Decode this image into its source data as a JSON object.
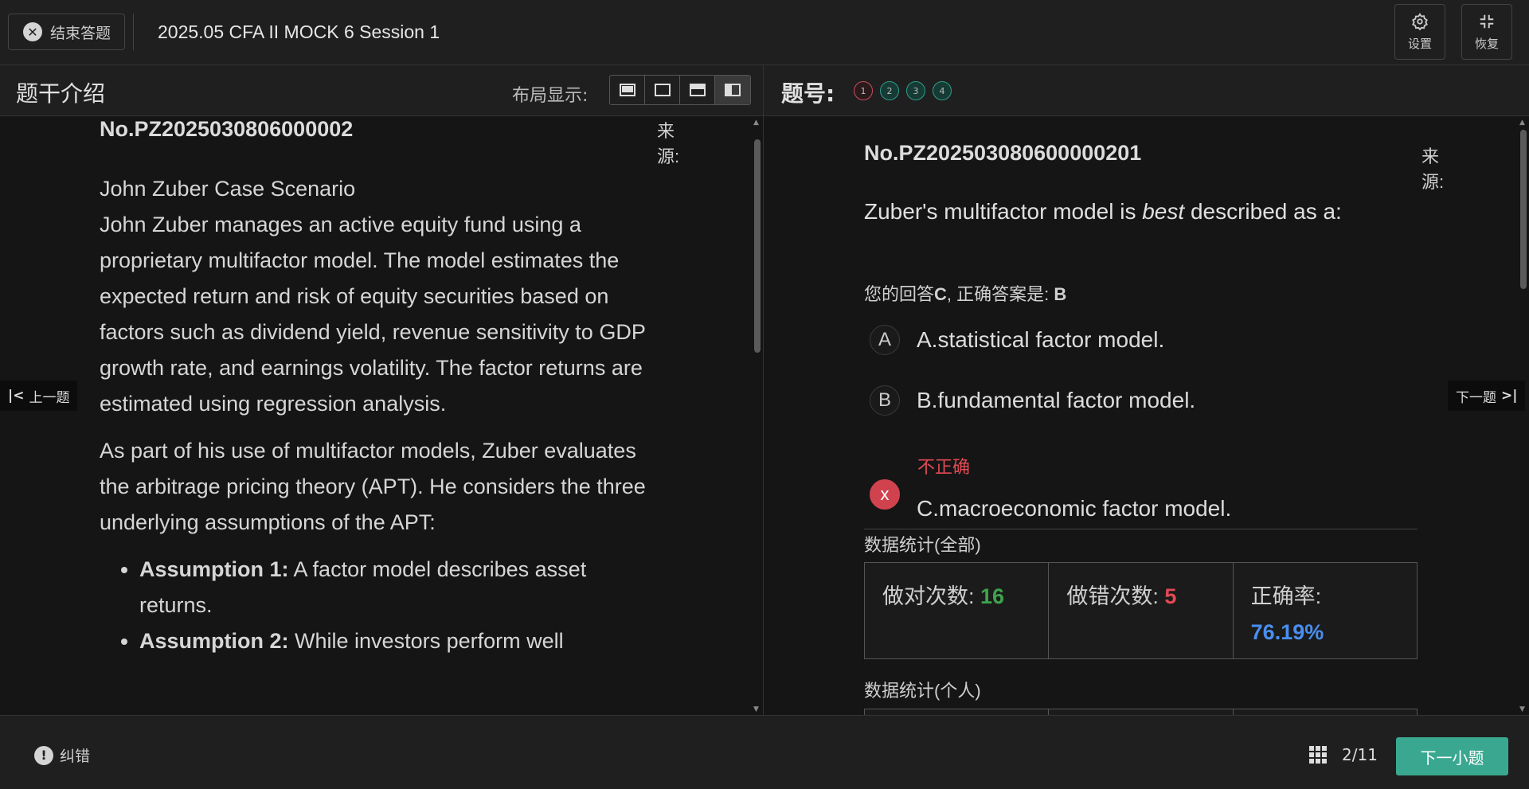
{
  "topbar": {
    "exit_label": "结束答题",
    "exam_title": "2025.05 CFA II MOCK 6 Session 1",
    "settings_label": "设置",
    "restore_label": "恢复"
  },
  "left_panel": {
    "title": "题干介绍",
    "layout_label": "布局显示:",
    "question_no": "No.PZ2025030806000002",
    "source_label": "来源:",
    "case_title": "John Zuber Case Scenario",
    "paragraph1": "John Zuber manages an active equity fund using a proprietary multifactor model. The model estimates the expected return and risk of equity securities based on factors such as dividend yield, revenue sensitivity to GDP growth rate, and earnings volatility. The factor returns are estimated using regression analysis.",
    "paragraph2": "As part of his use of multifactor models, Zuber evaluates the arbitrage pricing theory (APT). He considers the three underlying assumptions of the APT:",
    "assumption1_bold": "Assumption 1:",
    "assumption1_text": " A factor model describes asset returns.",
    "assumption2_bold": "Assumption 2:",
    "assumption2_text": " While investors perform well",
    "prev_label": "上一题"
  },
  "right_panel": {
    "title": "题号:",
    "question_numbers": [
      {
        "label": "1",
        "status": "wrong"
      },
      {
        "label": "2",
        "status": "right"
      },
      {
        "label": "3",
        "status": "right"
      },
      {
        "label": "4",
        "status": "right"
      }
    ],
    "question_no": "No.PZ202503080600000201",
    "source_label": "来源:",
    "question_pre": "Zuber's multifactor model is ",
    "question_em": "best",
    "question_post": " described as a:",
    "your_answer_label": "您的回答",
    "your_answer": "C",
    "correct_answer_label": ", 正确答案是: ",
    "correct_answer": "B",
    "options": [
      {
        "letter": "A",
        "text": "A.statistical factor model."
      },
      {
        "letter": "B",
        "text": "B.fundamental factor model."
      },
      {
        "letter": "x",
        "text": "C.macroeconomic factor model."
      }
    ],
    "incorrect_label": "不正确",
    "stats_all_title": "数据统计(全部)",
    "stats_personal_title": "数据统计(个人)",
    "correct_count_label": "做对次数: ",
    "correct_count": "16",
    "wrong_count_label": "做错次数: ",
    "wrong_count": "5",
    "accuracy_label": "正确率:",
    "accuracy": "76.19%",
    "next_label": "下一题"
  },
  "bottombar": {
    "report_label": "纠错",
    "progress": "2/11",
    "next_sub_label": "下一小题"
  },
  "colors": {
    "accent": "#3aa890",
    "wrong": "#e04a55",
    "correct": "#3ea34c",
    "accuracy": "#4a8ff0"
  }
}
